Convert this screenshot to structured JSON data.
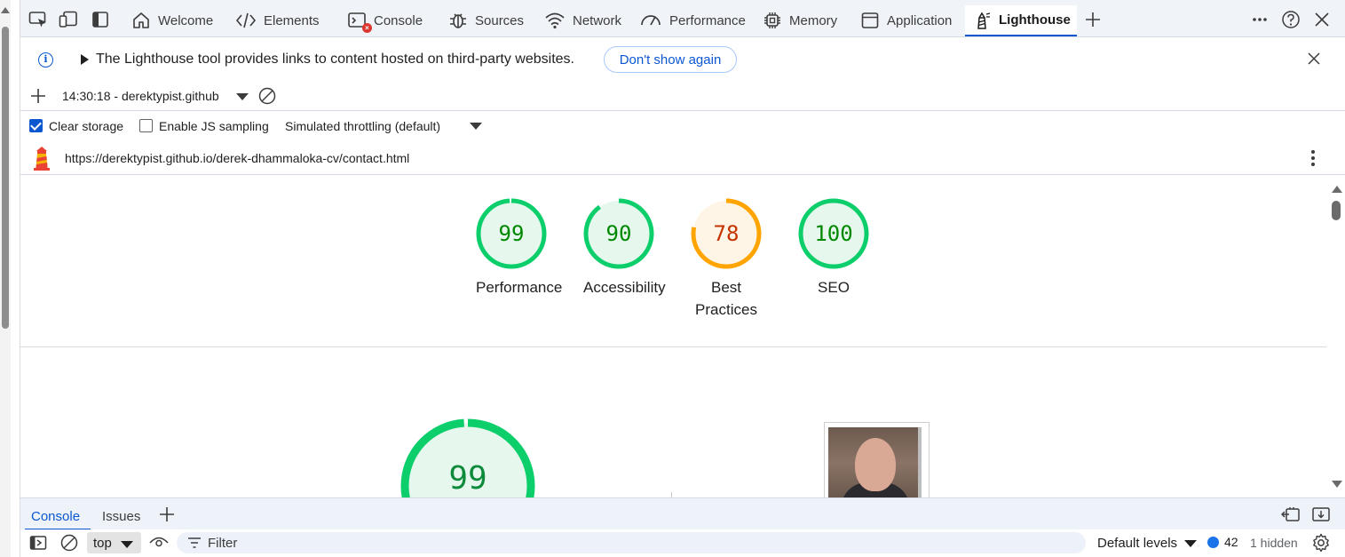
{
  "tabs": [
    {
      "label": "Welcome",
      "icon": "home-icon"
    },
    {
      "label": "Elements",
      "icon": "code-icon"
    },
    {
      "label": "Console",
      "icon": "console-icon"
    },
    {
      "label": "Sources",
      "icon": "bug-icon"
    },
    {
      "label": "Network",
      "icon": "wifi-icon"
    },
    {
      "label": "Performance",
      "icon": "gauge-icon"
    },
    {
      "label": "Memory",
      "icon": "chip-icon"
    },
    {
      "label": "Application",
      "icon": "window-icon"
    },
    {
      "label": "Lighthouse",
      "icon": "lighthouse-icon",
      "active": true
    }
  ],
  "infobar": {
    "message": "The Lighthouse tool provides links to content hosted on third-party websites.",
    "dont_show": "Don't show again"
  },
  "report_selector": {
    "name": "14:30:18 - derektypist.github"
  },
  "settings": {
    "clear_storage": "Clear storage",
    "clear_storage_checked": true,
    "js_sampling": "Enable JS sampling",
    "js_sampling_checked": false,
    "throttling": "Simulated throttling (default)"
  },
  "url": "https://derektypist.github.io/derek-dhammaloka-cv/contact.html",
  "scores": [
    {
      "label": "Performance",
      "value": "99",
      "status": "pass"
    },
    {
      "label": "Accessibility",
      "value": "90",
      "status": "pass"
    },
    {
      "label": "Best Practices",
      "value": "78",
      "status": "average"
    },
    {
      "label": "SEO",
      "value": "100",
      "status": "pass"
    }
  ],
  "big_score": "99",
  "colors": {
    "pass": "#0cce6b",
    "pass_text": "#008800",
    "pass_fill": "#e6f8ee",
    "average": "#ffa400",
    "average_text": "#c33300",
    "average_fill": "#fff5e6",
    "accent": "#0b57d0"
  },
  "drawer": {
    "tabs": [
      "Console",
      "Issues"
    ],
    "context": "top",
    "filter_placeholder": "Filter",
    "levels": "Default levels",
    "message_count": "42",
    "hidden": "1 hidden"
  }
}
